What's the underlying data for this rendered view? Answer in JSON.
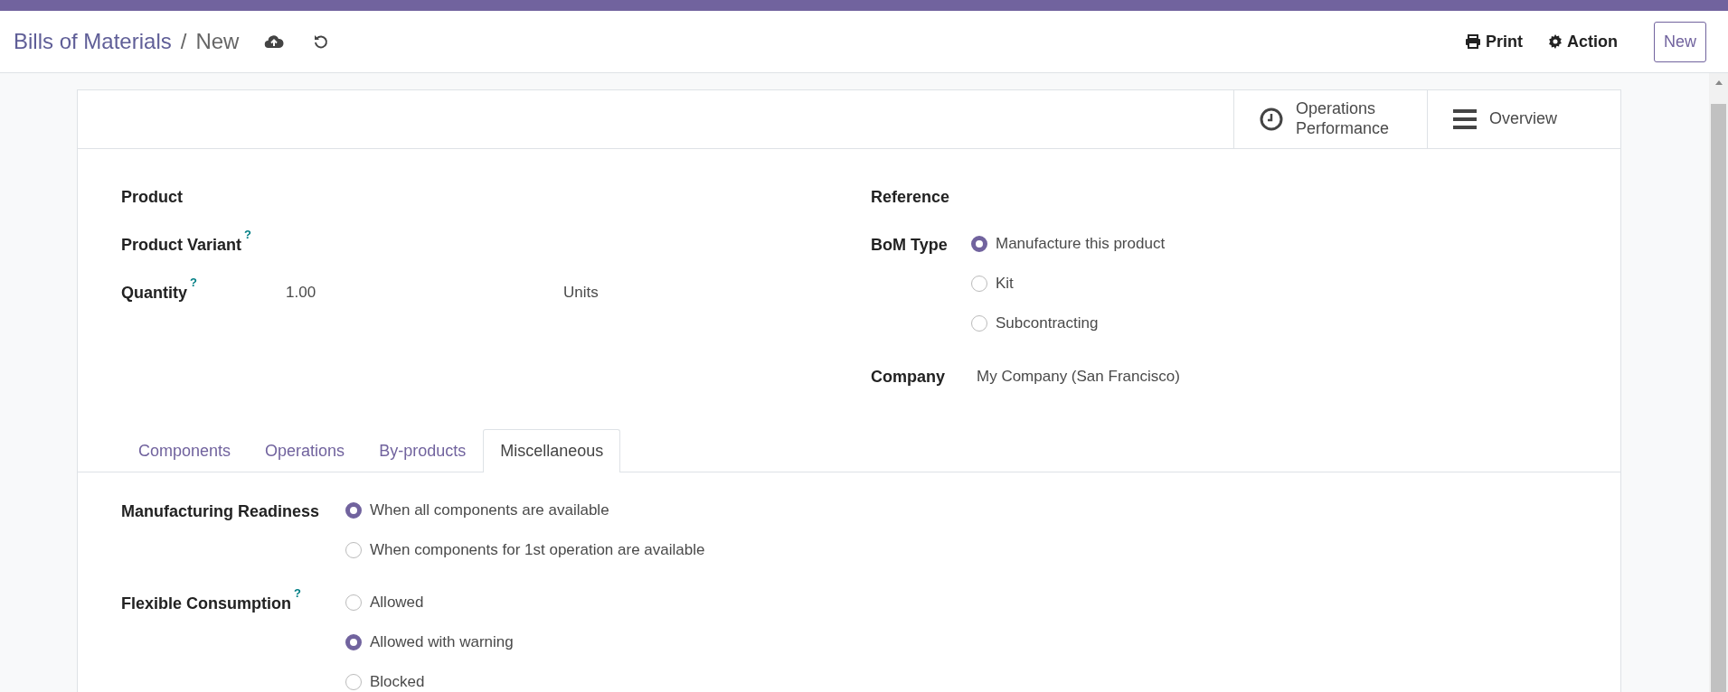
{
  "breadcrumbs": [
    {
      "label": "Bills of Materials",
      "kind": "link"
    },
    {
      "label": "New",
      "kind": "current"
    }
  ],
  "breadcrumb_separator": "/",
  "header_actions": [
    {
      "label": "Print",
      "kind": "print"
    },
    {
      "label": "Action",
      "kind": "gear"
    }
  ],
  "new_button": "New",
  "smart_buttons": [
    {
      "label": "Operations Performance",
      "kind": "clock"
    },
    {
      "label": "Overview",
      "kind": "bars"
    }
  ],
  "left_fields": [
    {
      "label": "Product",
      "kind": "text"
    },
    {
      "label": "Product Variant",
      "help": "?",
      "kind": "text"
    },
    {
      "label": "Quantity",
      "help": "?",
      "kind": "quantity",
      "value": "1.00",
      "unit": "Units"
    }
  ],
  "right_fields": [
    {
      "label": "Reference",
      "kind": "text"
    },
    {
      "label": "BoM Type",
      "kind": "radio",
      "options": [
        {
          "label": "Manufacture this product",
          "selected": true
        },
        {
          "label": "Kit",
          "selected": false
        },
        {
          "label": "Subcontracting",
          "selected": false
        }
      ]
    },
    {
      "label": "Company",
      "kind": "value",
      "value": "My Company (San Francisco)"
    }
  ],
  "tabs": [
    {
      "label": "Components",
      "selected": false
    },
    {
      "label": "Operations",
      "selected": false
    },
    {
      "label": "By-products",
      "selected": false
    },
    {
      "label": "Miscellaneous",
      "selected": true
    }
  ],
  "misc_fields": [
    {
      "label": "Manufacturing Readiness",
      "kind": "radio",
      "options": [
        {
          "label": "When all components are available",
          "selected": true
        },
        {
          "label": "When components for 1st operation are available",
          "selected": false
        }
      ]
    },
    {
      "label": "Flexible Consumption",
      "help": "?",
      "kind": "radio",
      "options": [
        {
          "label": "Allowed",
          "selected": false
        },
        {
          "label": "Allowed with warning",
          "selected": true
        },
        {
          "label": "Blocked",
          "selected": false
        }
      ]
    }
  ]
}
